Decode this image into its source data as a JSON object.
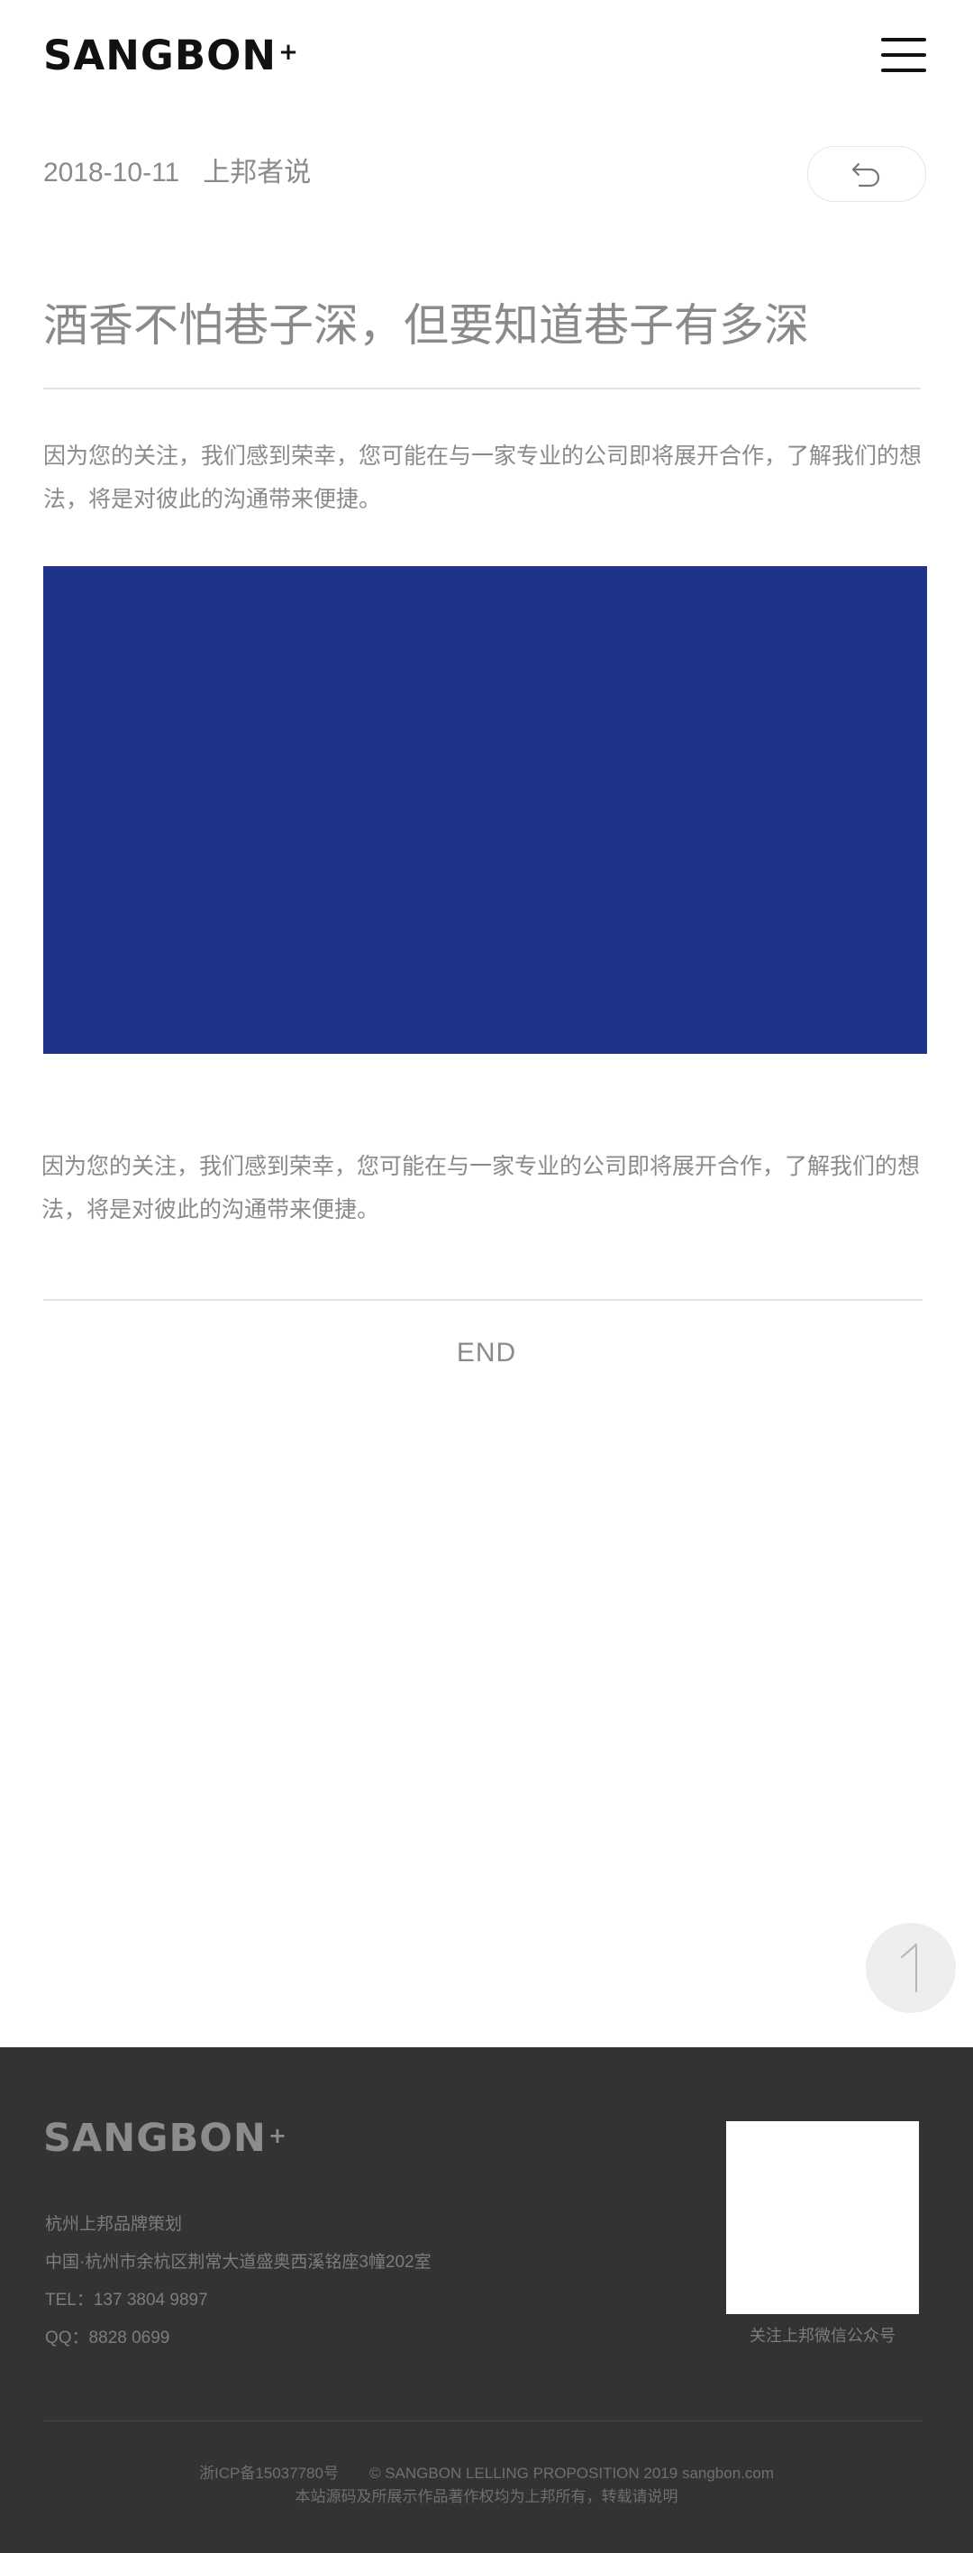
{
  "header": {
    "logo_text": "SANGBON",
    "logo_mark": "+",
    "menu_icon": "hamburger-menu-icon"
  },
  "article": {
    "date": "2018-10-11",
    "category": "上邦者说",
    "back_icon": "back-arrow-icon",
    "title": "酒香不怕巷子深，但要知道巷子有多深",
    "paragraph1": "因为您的关注，我们感到荣幸，您可能在与一家专业的公司即将展开合作，了解我们的想法，将是对彼此的沟通带来便捷。",
    "banner_color": "#1d3489",
    "paragraph2": "因为您的关注，我们感到荣幸，您可能在与一家专业的公司即将展开合作，了解我们的想法，将是对彼此的沟通带来便捷。",
    "end_label": "END"
  },
  "back_to_top_icon": "arrow-up-icon",
  "footer": {
    "logo_text": "SANGBON",
    "logo_mark": "+",
    "company": "杭州上邦品牌策划",
    "address": "中国·杭州市余杭区荆常大道盛奥西溪铭座3幢202室",
    "tel": "TEL：137 3804 9897",
    "qq": "QQ：8828 0699",
    "qr_caption": "关注上邦微信公众号",
    "icp": "浙ICP备15037780号",
    "copyright": "© SANGBON LELLING PROPOSITION 2019 sangbon.com",
    "notice": "本站源码及所展示作品著作权均为上邦所有，转载请说明"
  },
  "colors": {
    "banner": "#1d3489",
    "footer_bg": "#333333",
    "text": "#8a8a8a"
  }
}
